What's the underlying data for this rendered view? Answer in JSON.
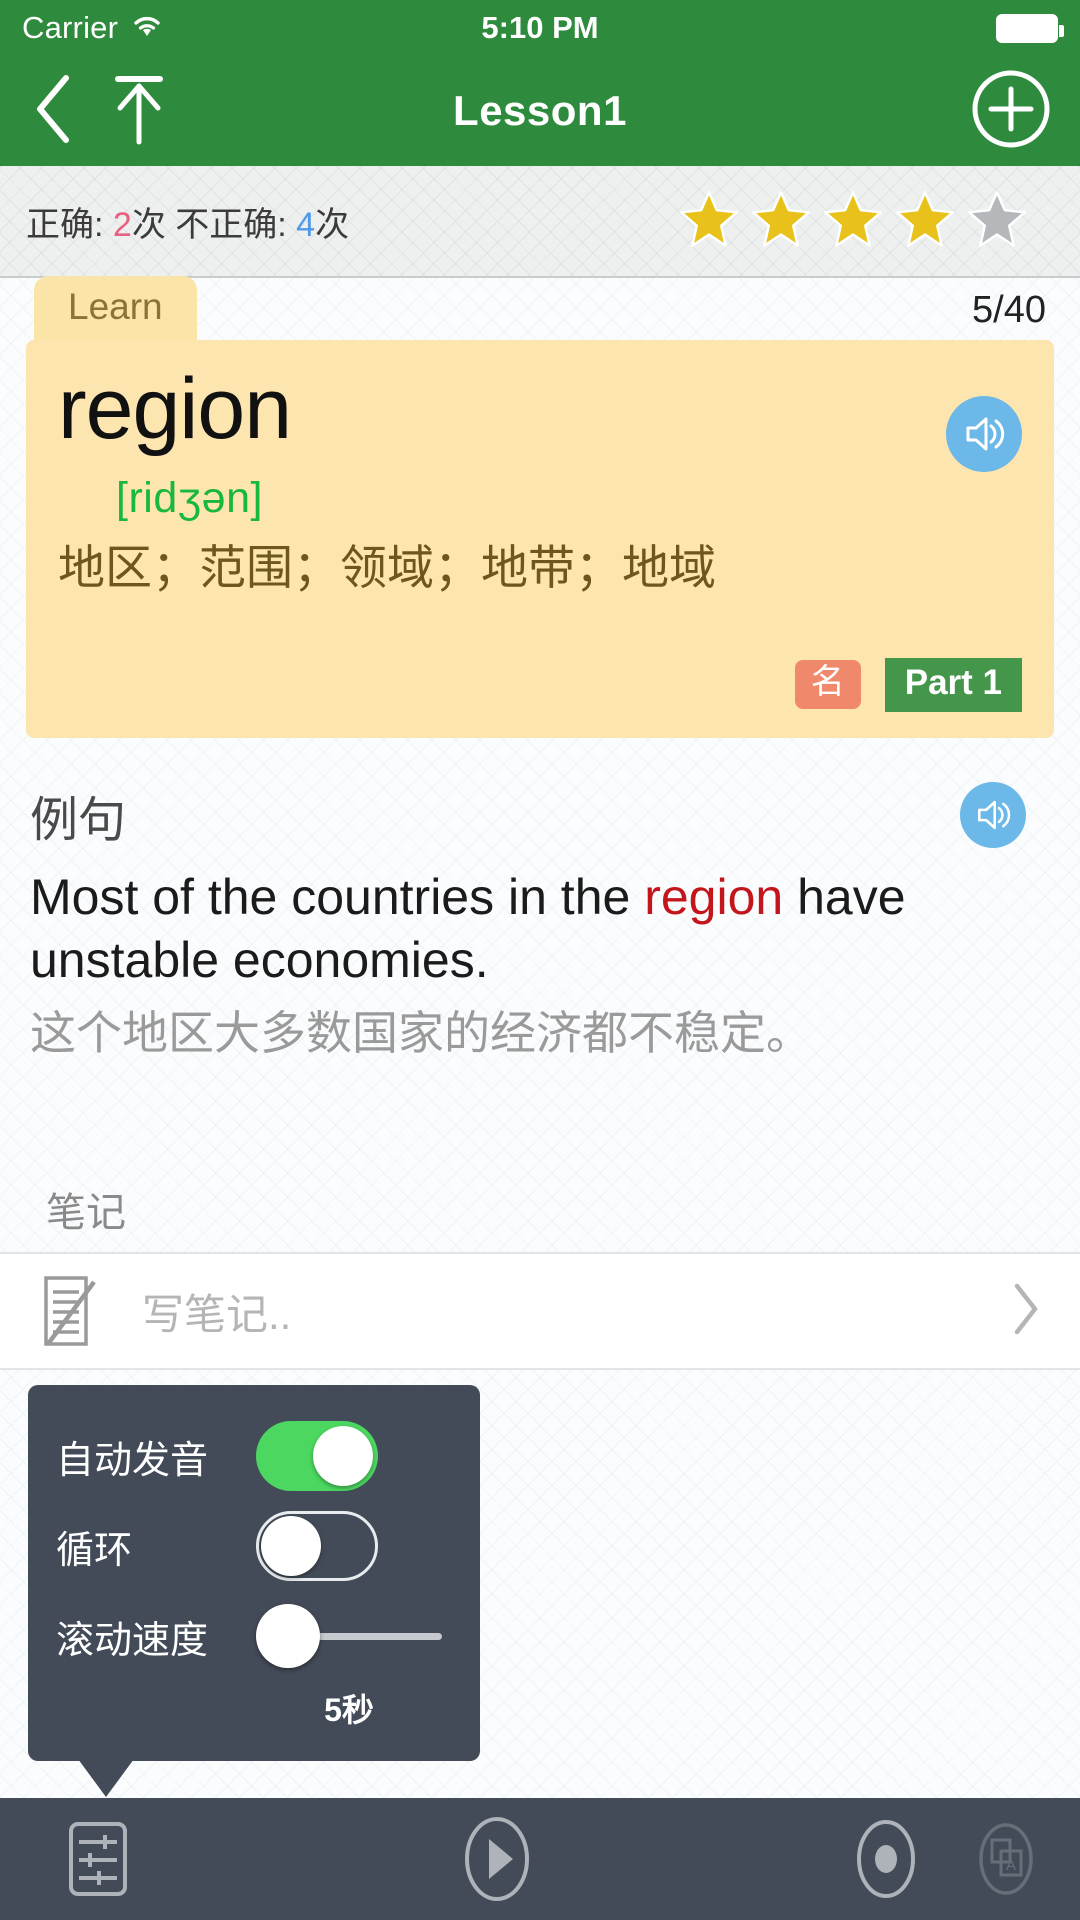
{
  "status_bar": {
    "carrier": "Carrier",
    "wifi_icon": "wifi-icon",
    "time": "5:10 PM",
    "battery_icon": "battery-full-icon"
  },
  "nav_bar": {
    "back_icon": "chevron-left-icon",
    "up_icon": "arrow-up-to-bar-icon",
    "title": "Lesson1",
    "add_icon": "plus-circle-icon"
  },
  "stats": {
    "correct_label": "正确: ",
    "correct_count": "2",
    "correct_unit": "次",
    "incorrect_label": " 不正确: ",
    "incorrect_count": "4",
    "incorrect_unit": "次",
    "stars_filled": 4,
    "stars_total": 5,
    "star_fill_color": "#e8c21a",
    "star_empty_color": "#b4b8ba"
  },
  "card": {
    "tab_label": "Learn",
    "counter": "5/40",
    "word": "region",
    "phonetic": "[ridʒən]",
    "definition": "地区；范围；领域；地带；地域",
    "speaker_icon": "speaker-icon",
    "badge_pos": "名",
    "badge_part": "Part 1",
    "card_bg_color": "#fce5ae",
    "phonetic_color": "#18b83c",
    "badge_pos_color": "#f0896b",
    "badge_part_color": "#43964a"
  },
  "example": {
    "label": "例句",
    "speaker_icon": "speaker-icon",
    "sentence_before": "Most of the countries in the ",
    "sentence_highlight": "region",
    "sentence_after": " have unstable economies.",
    "translation": "这个地区大多数国家的经济都不稳定。",
    "highlight_color": "#c3161c"
  },
  "notes": {
    "label": "笔记",
    "icon": "note-pencil-icon",
    "placeholder": "写笔记..",
    "chevron_icon": "chevron-right-icon"
  },
  "settings_popover": {
    "rows": [
      {
        "label": "自动发音",
        "type": "toggle",
        "state": "on"
      },
      {
        "label": "循环",
        "type": "toggle",
        "state": "off"
      },
      {
        "label": "滚动速度",
        "type": "slider",
        "value": "5秒",
        "position_percent": 0
      }
    ],
    "toggle_on_color": "#4cd760",
    "panel_color": "#434b58"
  },
  "toolbar": {
    "settings_icon": "sliders-icon",
    "play_icon": "play-icon",
    "record_icon": "record-icon",
    "card_icon": "translate-card-icon",
    "bg_color": "#434b58"
  },
  "theme": {
    "header_green": "#2e8b3d",
    "page_bg": "#fafcfd"
  }
}
